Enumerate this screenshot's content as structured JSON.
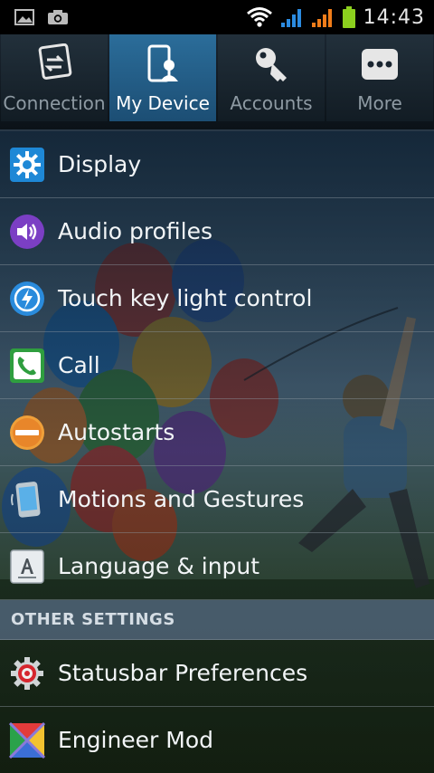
{
  "status_bar": {
    "time": "14:43",
    "left_icons": [
      "gallery-icon",
      "camera-icon"
    ],
    "right_icons": [
      "wifi-icon",
      "signal-1-icon",
      "signal-2-icon",
      "battery-icon"
    ]
  },
  "tabs": [
    {
      "label": "Connection",
      "icon": "connection-icon",
      "active": false
    },
    {
      "label": "My Device",
      "icon": "my-device-icon",
      "active": true
    },
    {
      "label": "Accounts",
      "icon": "accounts-icon",
      "active": false
    },
    {
      "label": "More",
      "icon": "more-icon",
      "active": false
    }
  ],
  "items": [
    {
      "label": "Display",
      "icon": "display-gear-icon"
    },
    {
      "label": "Audio profiles",
      "icon": "speaker-icon"
    },
    {
      "label": "Touch key light control",
      "icon": "touch-light-icon"
    },
    {
      "label": "Call",
      "icon": "phone-icon"
    },
    {
      "label": "Autostarts",
      "icon": "autostart-icon"
    },
    {
      "label": "Motions and Gestures",
      "icon": "motion-phone-icon"
    },
    {
      "label": "Language & input",
      "icon": "keyboard-icon"
    }
  ],
  "section_header": "OTHER SETTINGS",
  "other_items": [
    {
      "label": "Statusbar Preferences",
      "icon": "statusbar-gear-icon"
    },
    {
      "label": "Engineer Mod",
      "icon": "engineer-icon"
    }
  ],
  "colors": {
    "active_tab": "#2b6d9a",
    "section_header": "#50647a",
    "text": "#f2f5f7"
  }
}
